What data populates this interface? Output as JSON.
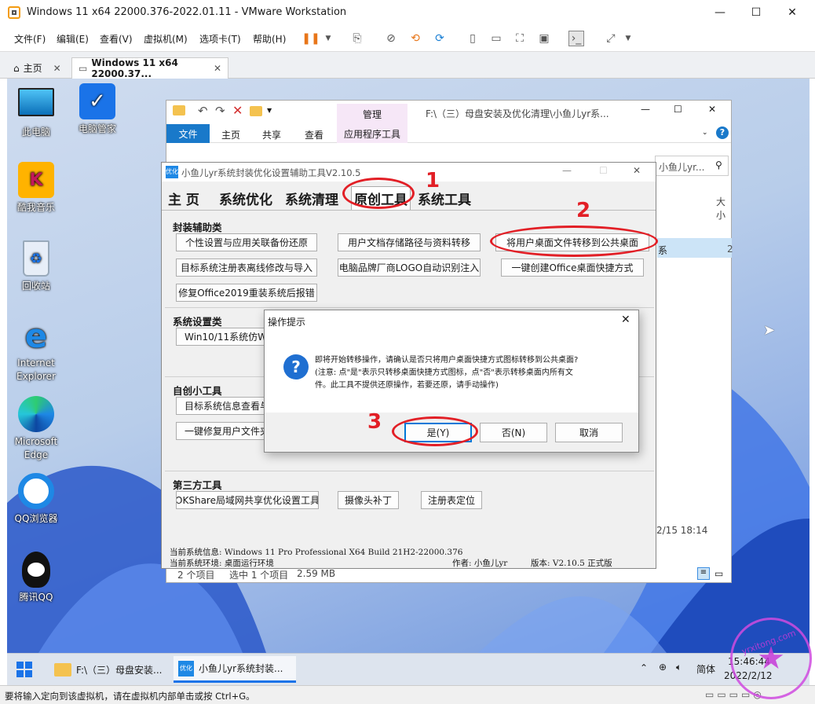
{
  "vm": {
    "title": "Windows 11 x64 22000.376-2022.01.11 - VMware Workstation",
    "menu": [
      "文件(F)",
      "编辑(E)",
      "查看(V)",
      "虚拟机(M)",
      "选项卡(T)",
      "帮助(H)"
    ],
    "tab_home": "主页",
    "tab_vm": "Windows 11 x64 22000.37...",
    "status": "要将输入定向到该虚拟机，请在虚拟机内部单击或按 Ctrl+G。"
  },
  "desktop": {
    "icons": [
      "此电脑",
      "电脑管家",
      "酷我音乐",
      "回收站",
      "Internet Explorer",
      "Microsoft Edge",
      "QQ浏览器",
      "腾讯QQ"
    ]
  },
  "explorer": {
    "manage": "管理",
    "path": "F:\\（三）母盘安装及优化清理\\小鱼儿yr系...",
    "ribbon_file": "文件",
    "ribbon_home": "主页",
    "ribbon_share": "共享",
    "ribbon_view": "查看",
    "ribbon_app": "应用程序工具",
    "search": "小鱼儿yr...",
    "size_col": "大小",
    "side_letter": "系",
    "side_num": "2",
    "date": "2/15 18:14",
    "status_items": "2 个项目",
    "status_selected": "选中 1 个项目",
    "status_size": "2.59 MB"
  },
  "tool": {
    "title": "小鱼儿yr系统封装优化设置辅助工具V2.10.5",
    "tabs": [
      "主 页",
      "系统优化",
      "系统清理",
      "原创工具",
      "系统工具"
    ],
    "sec1": "封装辅助类",
    "b1": "个性设置与应用关联备份还原",
    "b2": "用户文档存储路径与资料转移",
    "b3": "将用户桌面文件转移到公共桌面",
    "b4": "目标系统注册表离线修改与导入",
    "b5": "电脑品牌厂商LOGO自动识别注入",
    "b6": "一键创建Office桌面快捷方式",
    "b7": "修复Office2019重装系统后报错",
    "sec2": "系统设置类",
    "b8": "Win10/11系统仿Win",
    "sec3": "自创小工具",
    "b9": "目标系统信息查看与",
    "b10": "一键修复用户文件夹",
    "sec4": "第三方工具",
    "b11": "OKShare局域网共享优化设置工具",
    "b12": "摄像头补丁",
    "b13": "注册表定位",
    "info1": "当前系统信息: Windows 11 Pro Professional X64 Build 21H2-22000.376",
    "info2": "当前系统环境: 桌面运行环境",
    "author": "作者: 小鱼儿yr",
    "version": "版本: V2.10.5 正式版"
  },
  "dialog": {
    "title": "操作提示",
    "line1": "即将开始转移操作，请确认是否只将用户桌面快捷方式图标转移到公共桌面?",
    "line2": "(注意: 点\"是\"表示只转移桌面快捷方式图标，点\"否\"表示转移桌面内所有文",
    "line3": "件。此工具不提供还原操作，若要还原，请手动操作)",
    "yes": "是(Y)",
    "no": "否(N)",
    "cancel": "取消"
  },
  "annotations": {
    "n1": "1",
    "n2": "2",
    "n3": "3"
  },
  "taskbar": {
    "item1": "F:\\（三）母盘安装...",
    "item2": "小鱼儿yr系统封装...",
    "lang": "简体",
    "time": "15:46:44",
    "date": "2022/2/12"
  },
  "watermark": "yrxitong.com"
}
